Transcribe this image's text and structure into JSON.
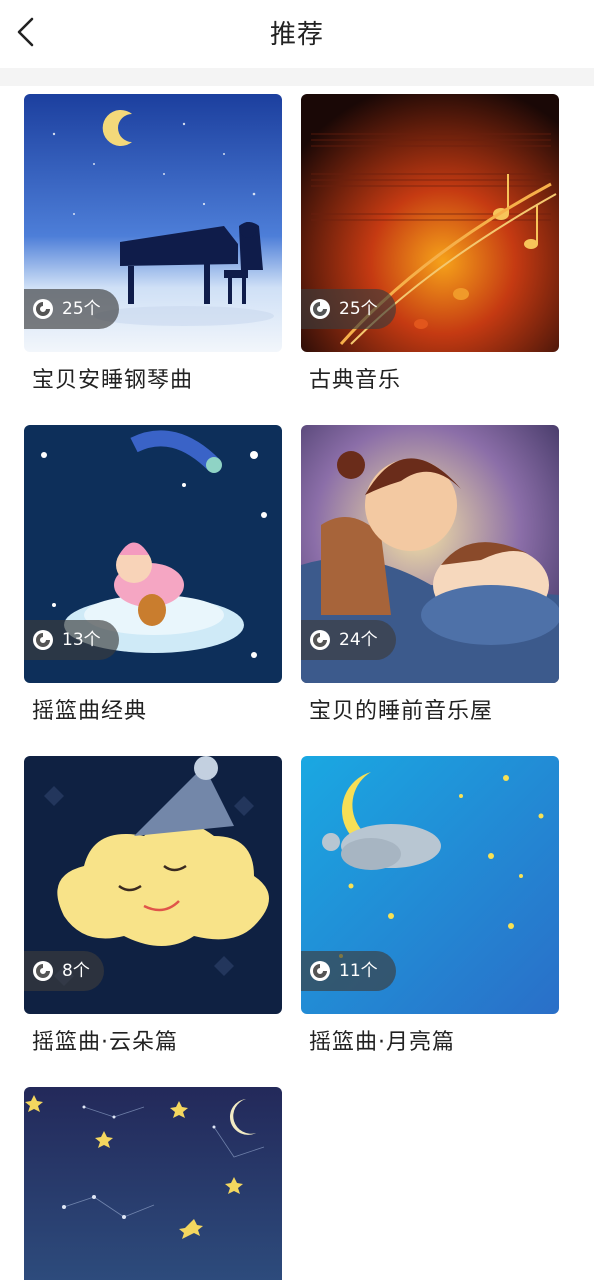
{
  "header": {
    "title": "推荐"
  },
  "albums": [
    {
      "name": "宝贝安睡钢琴曲",
      "count": "25个"
    },
    {
      "name": "古典音乐",
      "count": "25个"
    },
    {
      "name": "摇篮曲经典",
      "count": "13个"
    },
    {
      "name": "宝贝的睡前音乐屋",
      "count": "24个"
    },
    {
      "name": "摇篮曲·云朵篇",
      "count": "8个"
    },
    {
      "name": "摇篮曲·月亮篇",
      "count": "11个"
    }
  ],
  "theme": {
    "text": "#222222",
    "divider": "#f4f4f4",
    "pill": "#3c3c3c"
  }
}
